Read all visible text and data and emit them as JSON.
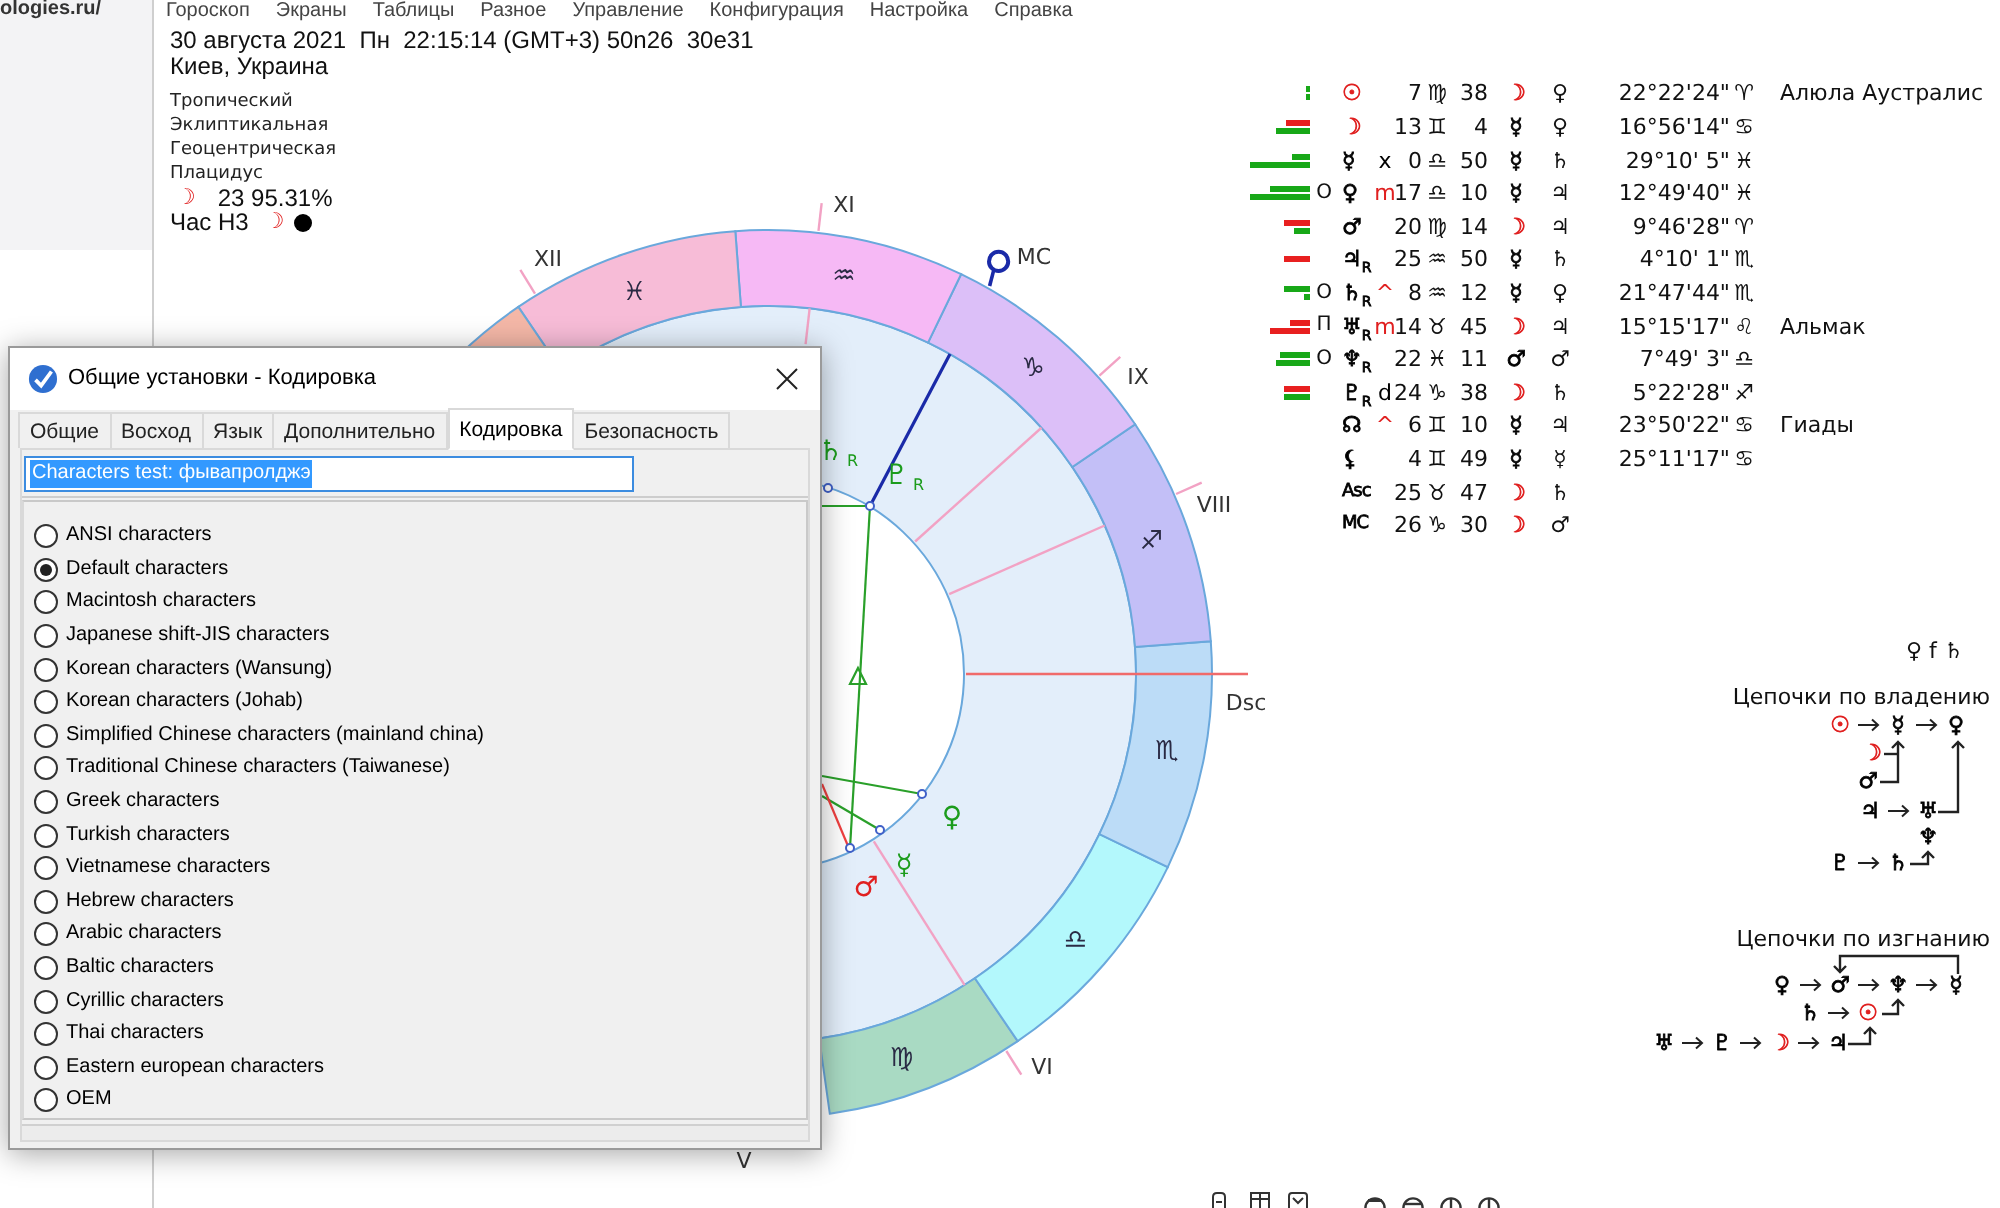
{
  "browser_page": {
    "url": "ologies.ru/"
  },
  "menu": [
    "Гороскоп",
    "Экраны",
    "Таблицы",
    "Разное",
    "Управление",
    "Конфигурация",
    "Настройка",
    "Справка"
  ],
  "chart_info": {
    "datetime": "30 августа 2021  Пн  22:15:14 (GMT+3) 50n26  30e31",
    "place": "Киев, Украина",
    "settings": [
      "Тропический",
      "Эклиптикальная",
      "Геоцентрическая",
      "Плацидус"
    ],
    "moon_phase": {
      "glyph": "☽",
      "text": "23 95.31%"
    },
    "planetary_hour": {
      "label": "Час Н3",
      "glyph": "☽"
    }
  },
  "wheel": {
    "signs": [
      {
        "glyph": "♍",
        "color": "#a9dac3"
      },
      {
        "glyph": "♎",
        "color": "#b3f8fc"
      },
      {
        "glyph": "♏",
        "color": "#bcdcf7"
      },
      {
        "glyph": "♐",
        "color": "#c3bff7"
      },
      {
        "glyph": "♑",
        "color": "#dcbff8"
      },
      {
        "glyph": "♒",
        "color": "#f6b9f5"
      },
      {
        "glyph": "♓",
        "color": "#f7bcd7"
      },
      {
        "color": "#f4b7a7"
      }
    ],
    "house_labels": [
      "XI",
      "XII",
      "MC",
      "IX",
      "VIII",
      "Dsc",
      "VI",
      "V"
    ],
    "planets": [
      {
        "glyph": "♄",
        "suffix": "R",
        "color": "#1c9c1c"
      },
      {
        "glyph": "♇",
        "suffix": "R",
        "color": "#1c9c1c"
      },
      {
        "glyph": "♀",
        "color": "#1c9c1c"
      },
      {
        "glyph": "☿",
        "color": "#1c9c1c"
      },
      {
        "glyph": "♂",
        "color": "#e02020"
      }
    ]
  },
  "table": {
    "rows": [
      {
        "kind": "planet",
        "bars": [
          {
            "color": "#18a818"
          },
          {
            "color": "#18a818"
          }
        ],
        "planet": {
          "text": "☉",
          "color": "#e02020"
        },
        "deg": "7",
        "sign": "♍",
        "min": "38",
        "ruler": {
          "text": "☽",
          "color": "#e02020"
        },
        "lord": "♀",
        "pos": "22°22'24\"",
        "pos_sign": "♈",
        "star": "Алюла Аустралис"
      },
      {
        "kind": "planet",
        "bars": [
          {
            "color": "#e82020"
          },
          {
            "color": "#18a818"
          }
        ],
        "planet": {
          "text": "☽",
          "color": "#e02020"
        },
        "deg": "13",
        "sign": "♊",
        "min": "4",
        "ruler": {
          "text": "☿",
          "color": "#000000"
        },
        "lord": "♀",
        "pos": "16°56'14\"",
        "pos_sign": "♋"
      },
      {
        "kind": "planet",
        "bars": [
          {
            "color": "#18a818"
          },
          {
            "color": "#18a818"
          }
        ],
        "planet": {
          "text": "☿",
          "color": "#000000"
        },
        "mod": {
          "text": "x",
          "color": "#000000"
        },
        "deg": "0",
        "sign": "♎",
        "min": "50",
        "ruler": {
          "text": "☿",
          "color": "#000000"
        },
        "lord": "♄",
        "pos": "29°10' 5\"",
        "pos_sign": "♓"
      },
      {
        "kind": "planet",
        "bars": [
          {
            "color": "#18a818"
          },
          {
            "color": "#18a818"
          }
        ],
        "mark": "О",
        "planet": {
          "text": "♀",
          "color": "#000000"
        },
        "mod": {
          "text": "m",
          "color": "#e02020"
        },
        "deg": "17",
        "sign": "♎",
        "min": "10",
        "ruler": {
          "text": "☿",
          "color": "#000000"
        },
        "lord": "♃",
        "pos": "12°49'40\"",
        "pos_sign": "♓"
      },
      {
        "kind": "planet",
        "bars": [
          {
            "color": "#e82020"
          },
          {
            "color": "#18a818"
          }
        ],
        "planet": {
          "text": "♂",
          "color": "#000000"
        },
        "deg": "20",
        "sign": "♍",
        "min": "14",
        "ruler": {
          "text": "☽",
          "color": "#e02020"
        },
        "lord": "♃",
        "pos": "9°46'28\"",
        "pos_sign": "♈"
      },
      {
        "kind": "planet",
        "bars": [
          {
            "color": "#e82020"
          }
        ],
        "planet": {
          "text": "♃",
          "color": "#000000"
        },
        "suffix": "R",
        "deg": "25",
        "sign": "♒",
        "min": "50",
        "ruler": {
          "text": "☿",
          "color": "#000000"
        },
        "lord": "♄",
        "pos": "4°10' 1\"",
        "pos_sign": "♏"
      },
      {
        "kind": "planet",
        "bars": [
          {
            "color": "#18a818"
          },
          {
            "color": "#18a818"
          }
        ],
        "mark": "О",
        "planet": {
          "text": "♄",
          "color": "#000000"
        },
        "suffix": "R",
        "mod": {
          "text": "^",
          "color": "#e02020"
        },
        "deg": "8",
        "sign": "♒",
        "min": "12",
        "ruler": {
          "text": "☿",
          "color": "#000000"
        },
        "lord": "♀",
        "pos": "21°47'44\"",
        "pos_sign": "♏"
      },
      {
        "kind": "planet",
        "bars": [
          {
            "color": "#e82020"
          },
          {
            "color": "#e82020"
          }
        ],
        "mark": "П",
        "planet": {
          "text": "♅",
          "color": "#000000"
        },
        "suffix": "R",
        "mod": {
          "text": "m",
          "color": "#e02020"
        },
        "deg": "14",
        "sign": "♉",
        "min": "45",
        "ruler": {
          "text": "☽",
          "color": "#e02020"
        },
        "lord": "♃",
        "pos": "15°15'17\"",
        "pos_sign": "♌",
        "star": "Альмак"
      },
      {
        "kind": "planet",
        "bars": [
          {
            "color": "#18a818"
          },
          {
            "color": "#18a818"
          }
        ],
        "mark": "О",
        "planet": {
          "text": "♆",
          "color": "#000000"
        },
        "suffix": "R",
        "deg": "22",
        "sign": "♓",
        "min": "11",
        "ruler": {
          "text": "♂",
          "color": "#000000"
        },
        "lord": "♂",
        "pos": "7°49' 3\"",
        "pos_sign": "♎"
      },
      {
        "kind": "planet",
        "bars": [
          {
            "color": "#e82020"
          },
          {
            "color": "#18a818"
          }
        ],
        "planet": {
          "text": "♇",
          "color": "#000000"
        },
        "suffix": "R",
        "mod": {
          "text": "d",
          "color": "#000000"
        },
        "deg": "24",
        "sign": "♑",
        "min": "38",
        "ruler": {
          "text": "☽",
          "color": "#e02020"
        },
        "lord": "♄",
        "pos": "5°22'28\"",
        "pos_sign": "♐"
      },
      {
        "kind": "point",
        "planet": {
          "text": "☊",
          "color": "#000000"
        },
        "mod": {
          "text": "^",
          "color": "#e02020"
        },
        "deg": "6",
        "sign": "♊",
        "min": "10",
        "ruler": {
          "text": "☿",
          "color": "#000000"
        },
        "lord": "♃",
        "pos": "23°50'22\"",
        "pos_sign": "♋",
        "star": "Гиады"
      },
      {
        "kind": "point",
        "planet": {
          "text": "⚸",
          "color": "#000000"
        },
        "deg": "4",
        "sign": "♊",
        "min": "49",
        "ruler": {
          "text": "☿",
          "color": "#000000"
        },
        "lord": "☿",
        "pos": "25°11'17\"",
        "pos_sign": "♋"
      },
      {
        "kind": "angle",
        "planet": {
          "text": "Asc",
          "color": "#000000"
        },
        "deg": "25",
        "sign": "♉",
        "min": "47",
        "ruler": {
          "text": "☽",
          "color": "#e02020"
        },
        "lord": "♄"
      },
      {
        "kind": "angle",
        "planet": {
          "text": "MC",
          "color": "#000000"
        },
        "deg": "26",
        "sign": "♑",
        "min": "30",
        "ruler": {
          "text": "☽",
          "color": "#e02020"
        },
        "lord": "♂"
      }
    ]
  },
  "chains": {
    "reception": "♀ f ♄",
    "groups": [
      {
        "title": "Цепочки по владению",
        "rows": [
          {
            "nodes": [
              {
                "text": "☉",
                "color": "#e02020"
              },
              {
                "text": "☿",
                "color": "#000000"
              },
              {
                "text": "♀",
                "color": "#000000"
              }
            ]
          },
          {
            "nodes": [
              {
                "text": "☽",
                "color": "#e02020"
              }
            ]
          },
          {
            "nodes": [
              {
                "text": "♂",
                "color": "#000000"
              }
            ]
          },
          {
            "nodes": [
              {
                "text": "♃",
                "color": "#000000"
              },
              {
                "text": "♅",
                "color": "#000000"
              }
            ]
          },
          {
            "nodes": [
              {
                "text": "♆",
                "color": "#000000"
              }
            ]
          },
          {
            "nodes": [
              {
                "text": "♇",
                "color": "#000000"
              },
              {
                "text": "♄",
                "color": "#000000"
              }
            ]
          }
        ]
      },
      {
        "title": "Цепочки по изгнанию",
        "rows": [
          {
            "nodes": [
              {
                "text": "♀",
                "color": "#000000"
              },
              {
                "text": "♂",
                "color": "#000000"
              },
              {
                "text": "♆",
                "color": "#000000"
              },
              {
                "text": "☿",
                "color": "#000000"
              }
            ]
          },
          {
            "nodes": [
              {
                "text": "♄",
                "color": "#000000"
              },
              {
                "text": "☉",
                "color": "#e02020"
              }
            ]
          },
          {
            "nodes": [
              {
                "text": "♅",
                "color": "#000000"
              },
              {
                "text": "♇",
                "color": "#000000"
              },
              {
                "text": "☽",
                "color": "#e02020"
              },
              {
                "text": "♃",
                "color": "#000000"
              }
            ]
          }
        ]
      }
    ]
  },
  "dialog": {
    "title": "Общие установки - Кодировка",
    "tabs": [
      {
        "label": "Общие",
        "selected": false
      },
      {
        "label": "Восход",
        "selected": false
      },
      {
        "label": "Язык",
        "selected": false
      },
      {
        "label": "Дополнительно",
        "selected": false
      },
      {
        "label": "Кодировка",
        "selected": true
      },
      {
        "label": "Безопасность",
        "selected": false
      }
    ],
    "test_field": {
      "value": "Characters test: фывапролджэ",
      "text_selected": true
    },
    "charsets": [
      {
        "label": "ANSI characters",
        "selected": false
      },
      {
        "label": "Default characters",
        "selected": true
      },
      {
        "label": "Macintosh characters",
        "selected": false
      },
      {
        "label": "Japanese shift-JIS characters",
        "selected": false
      },
      {
        "label": "Korean characters (Wansung)",
        "selected": false
      },
      {
        "label": "Korean characters (Johab)",
        "selected": false
      },
      {
        "label": "Simplified Chinese characters (mainland china)",
        "selected": false
      },
      {
        "label": "Traditional Chinese characters (Taiwanese)",
        "selected": false
      },
      {
        "label": "Greek characters",
        "selected": false
      },
      {
        "label": "Turkish characters",
        "selected": false
      },
      {
        "label": "Vietnamese characters",
        "selected": false
      },
      {
        "label": "Hebrew characters",
        "selected": false
      },
      {
        "label": "Arabic characters",
        "selected": false
      },
      {
        "label": "Baltic characters",
        "selected": false
      },
      {
        "label": "Cyrillic characters",
        "selected": false
      },
      {
        "label": "Thai characters",
        "selected": false
      },
      {
        "label": "Eastern european characters",
        "selected": false
      },
      {
        "label": "OEM",
        "selected": false
      }
    ]
  }
}
